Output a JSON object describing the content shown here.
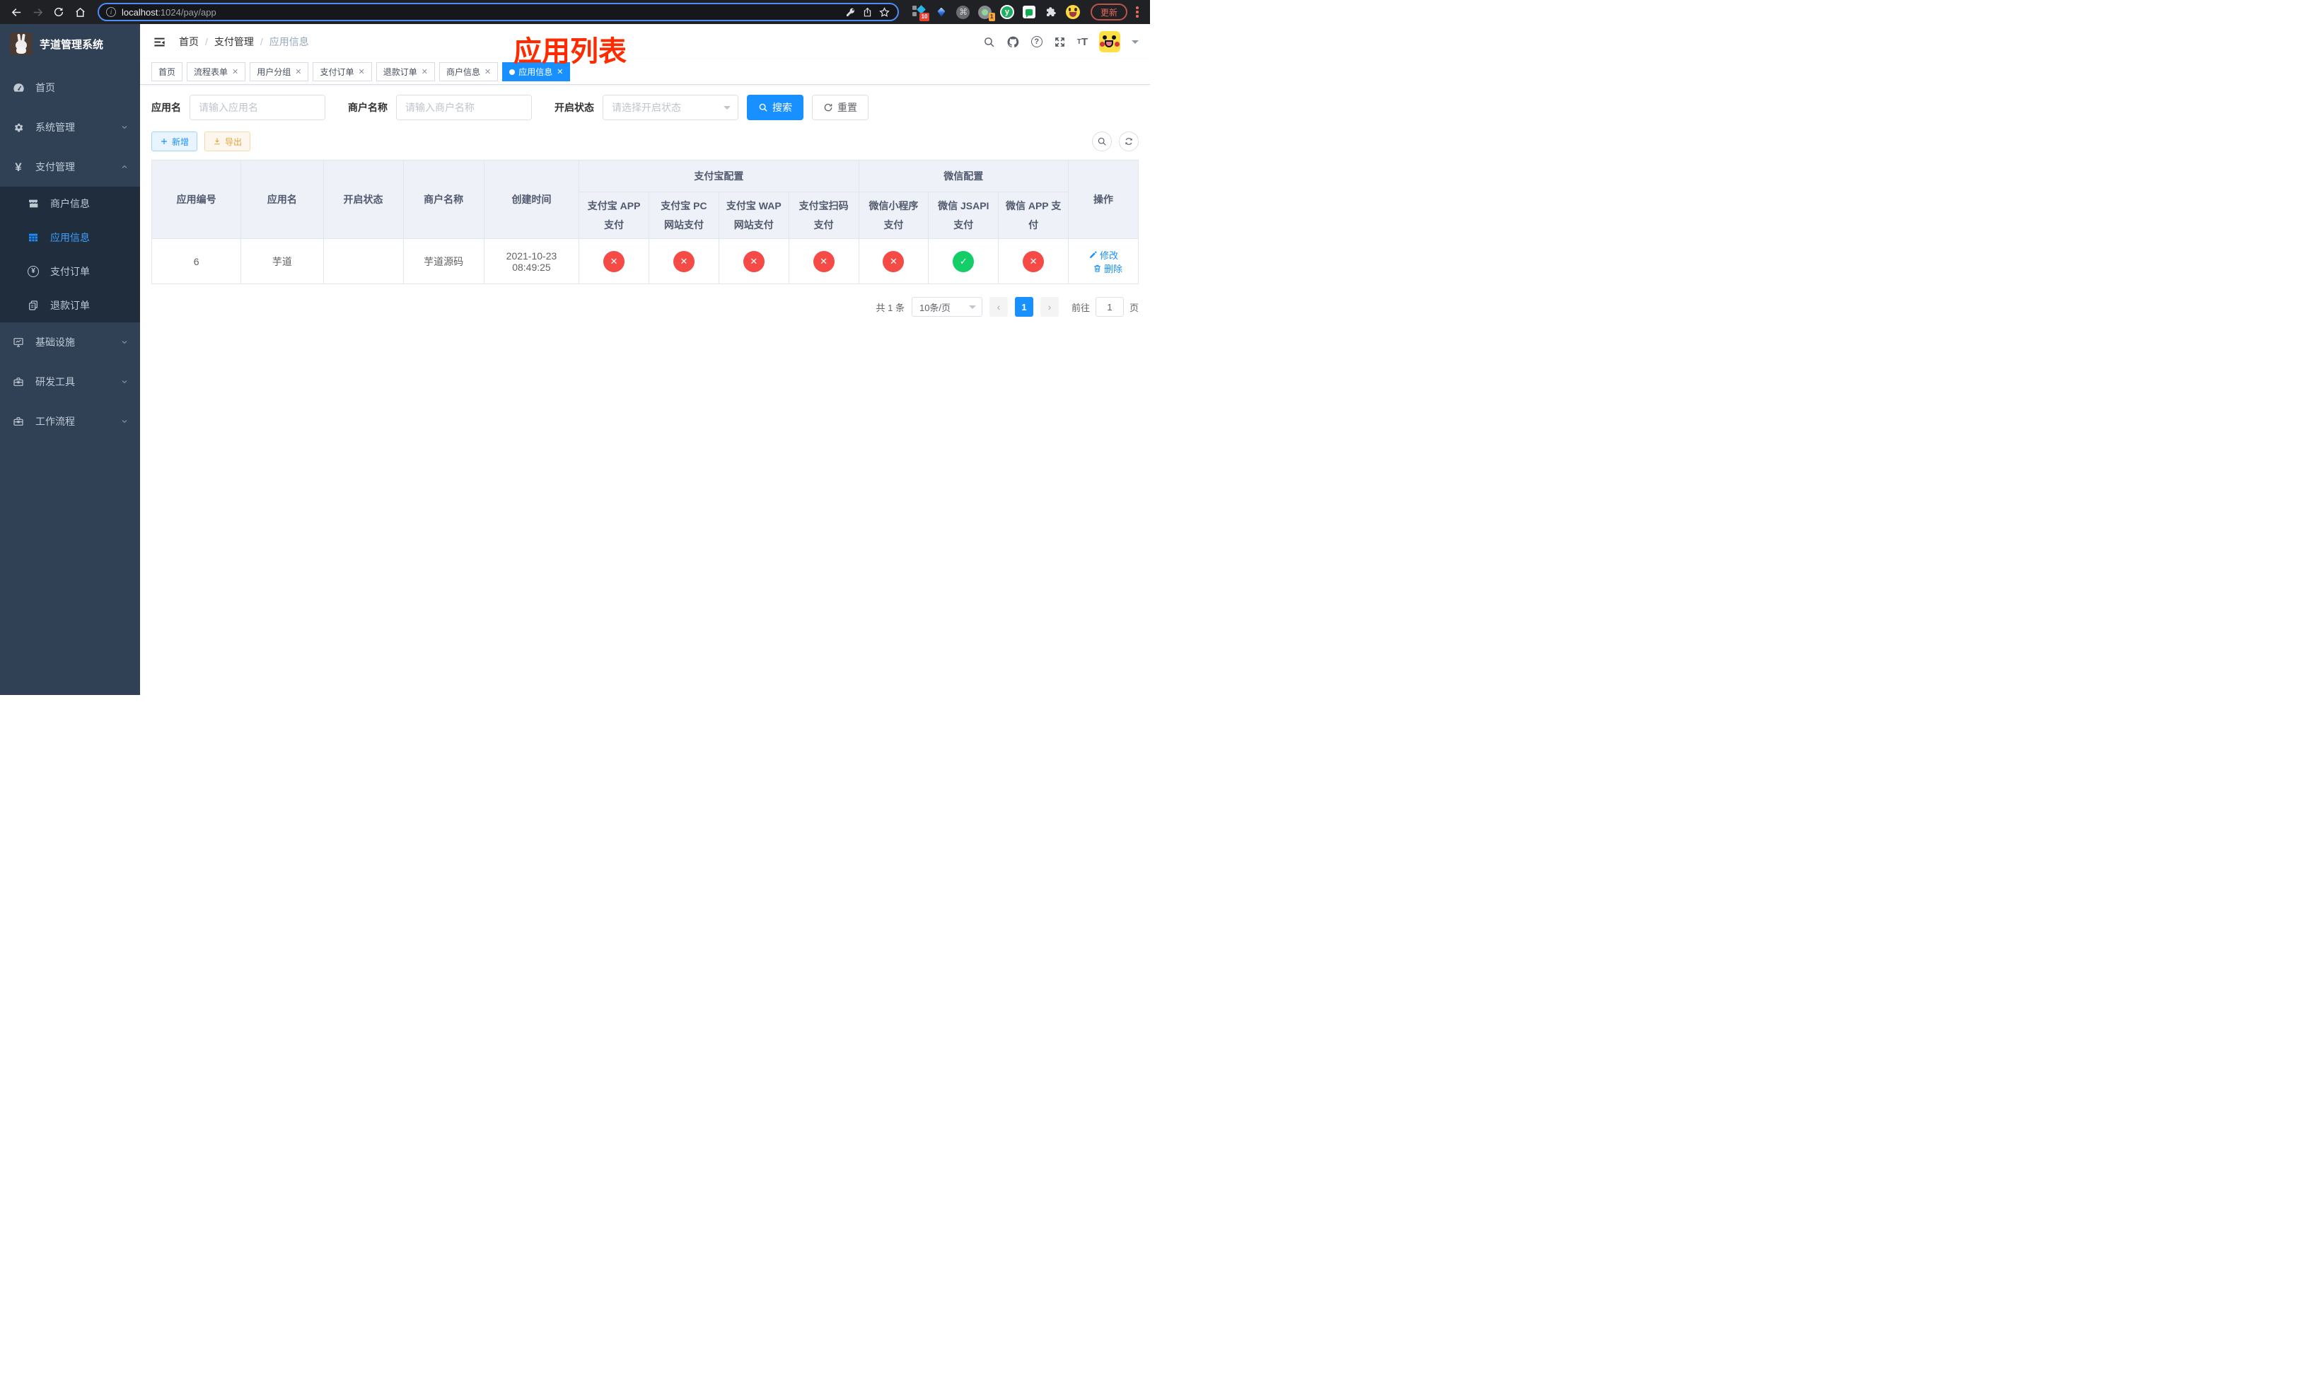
{
  "browser": {
    "url_host": "localhost",
    "url_path": ":1024/pay/app",
    "update_button": "更新",
    "ext_badge_pinned": "10",
    "ext_badge_recorder": "1"
  },
  "sidebar": {
    "logo_title": "芋道管理系统",
    "items": [
      {
        "label": "首页"
      },
      {
        "label": "系统管理"
      },
      {
        "label": "支付管理"
      },
      {
        "label": "基础设施"
      },
      {
        "label": "研发工具"
      },
      {
        "label": "工作流程"
      }
    ],
    "payment_submenu": [
      {
        "label": "商户信息"
      },
      {
        "label": "应用信息"
      },
      {
        "label": "支付订单"
      },
      {
        "label": "退款订单"
      }
    ]
  },
  "navbar": {
    "breadcrumb": [
      "首页",
      "支付管理",
      "应用信息"
    ]
  },
  "annotation": "应用列表",
  "tabs": [
    {
      "label": "首页"
    },
    {
      "label": "流程表单"
    },
    {
      "label": "用户分组"
    },
    {
      "label": "支付订单"
    },
    {
      "label": "退款订单"
    },
    {
      "label": "商户信息"
    },
    {
      "label": "应用信息"
    }
  ],
  "filters": {
    "app_name_label": "应用名",
    "app_name_placeholder": "请输入应用名",
    "merchant_label": "商户名称",
    "merchant_placeholder": "请输入商户名称",
    "status_label": "开启状态",
    "status_placeholder": "请选择开启状态",
    "search_button": "搜索",
    "reset_button": "重置"
  },
  "toolbar": {
    "add_button": "新增",
    "export_button": "导出"
  },
  "table": {
    "columns": {
      "app_id": "应用编号",
      "app_name": "应用名",
      "status": "开启状态",
      "merchant": "商户名称",
      "created": "创建时间",
      "alipay_group": "支付宝配置",
      "wechat_group": "微信配置",
      "alipay_app": "支付宝 APP 支付",
      "alipay_pc": "支付宝 PC 网站支付",
      "alipay_wap": "支付宝 WAP 网站支付",
      "alipay_qr": "支付宝扫码支付",
      "wx_mini": "微信小程序支付",
      "wx_jsapi": "微信 JSAPI 支付",
      "wx_app": "微信 APP 支付",
      "ops": "操作"
    },
    "rows": [
      {
        "app_id": "6",
        "app_name": "芋道",
        "enabled": true,
        "merchant": "芋道源码",
        "created": "2021-10-23 08:49:25",
        "pay_channels": [
          false,
          false,
          false,
          false,
          false,
          true,
          false
        ],
        "edit_label": "修改",
        "delete_label": "删除"
      }
    ]
  },
  "pagination": {
    "total": "共 1 条",
    "page_size": "10条/页",
    "current_page": "1",
    "goto_prefix": "前往",
    "goto_value": "1",
    "goto_suffix": "页"
  }
}
